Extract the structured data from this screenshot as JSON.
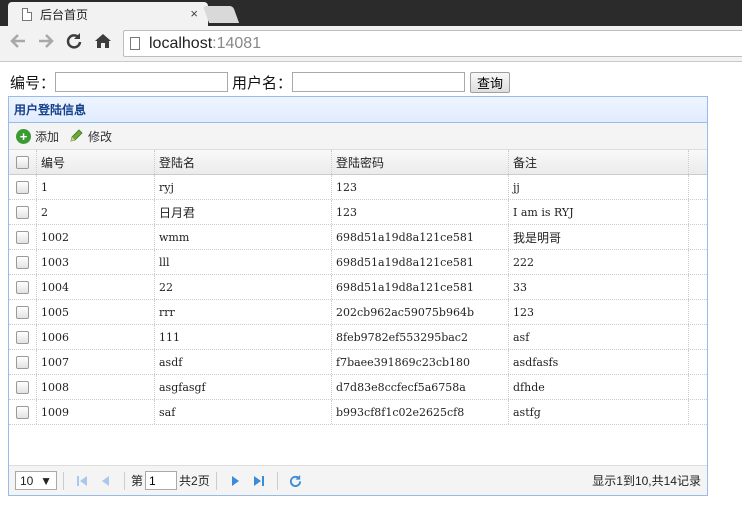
{
  "browser": {
    "tab_title": "后台首页",
    "tab_close": "×",
    "url_host": "localhost",
    "url_port": ":14081"
  },
  "search": {
    "id_label": "编号：",
    "user_label": "用户名：",
    "query_button": "查询"
  },
  "panel": {
    "title": "用户登陆信息",
    "add_label": "添加",
    "edit_label": "修改"
  },
  "grid": {
    "columns": [
      "编号",
      "登陆名",
      "登陆密码",
      "备注"
    ],
    "rows": [
      [
        "1",
        "ryj",
        "123",
        "jj"
      ],
      [
        "2",
        "日月君",
        "123",
        "I am is RYJ"
      ],
      [
        "1002",
        "wmm",
        "698d51a19d8a121ce581",
        "我是明哥"
      ],
      [
        "1003",
        "lll",
        "698d51a19d8a121ce581",
        "222"
      ],
      [
        "1004",
        "22",
        "698d51a19d8a121ce581",
        "33"
      ],
      [
        "1005",
        "rrr",
        "202cb962ac59075b964b",
        "123"
      ],
      [
        "1006",
        "111",
        "8feb9782ef553295bac2",
        "asf"
      ],
      [
        "1007",
        "asdf",
        "f7baee391869c23cb180",
        "asdfasfs"
      ],
      [
        "1008",
        "asgfasgf",
        "d7d83e8ccfecf5a6758a",
        "dfhde"
      ],
      [
        "1009",
        "saf",
        "b993cf8f1c02e2625cf8",
        "astfg"
      ]
    ]
  },
  "pager": {
    "page_size": "10",
    "page_prefix": "第",
    "page_value": "1",
    "page_total": "共2页",
    "info": "显示1到10,共14记录"
  },
  "colors": {
    "panel_border": "#99bbe8",
    "panel_title": "#15428b",
    "pager_icon": "#3b8bd7"
  }
}
